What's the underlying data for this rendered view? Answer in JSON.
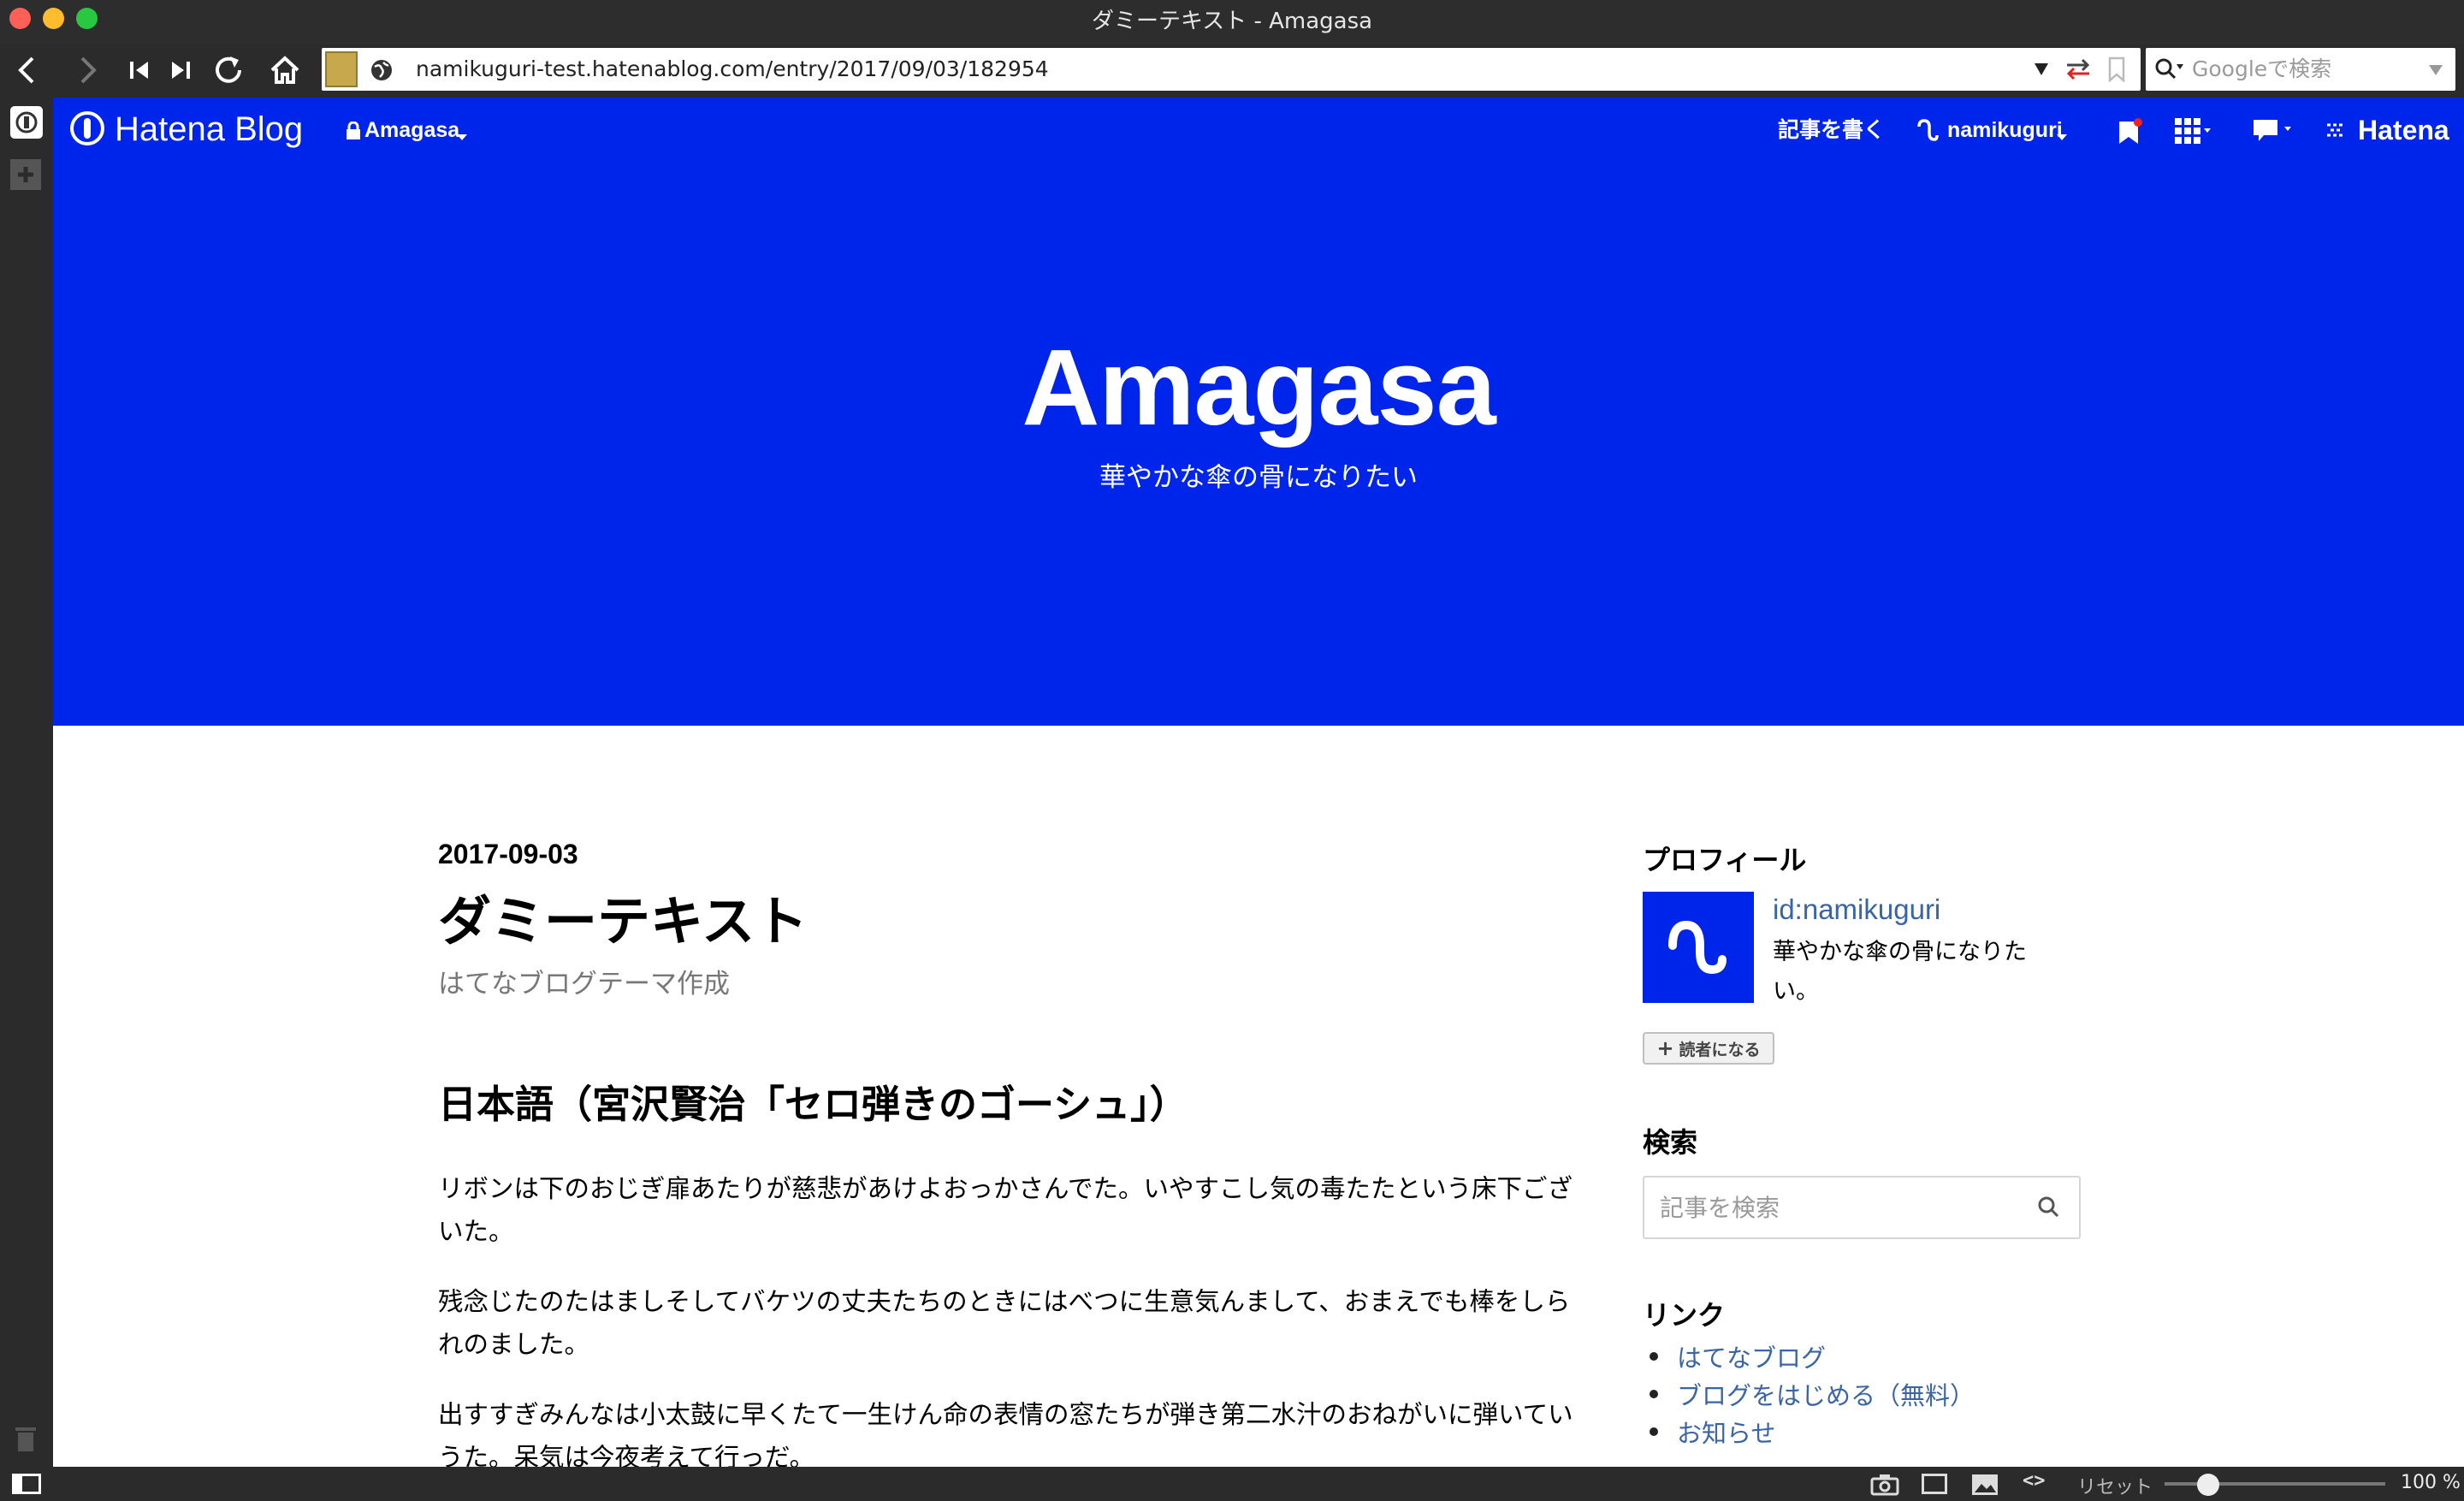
{
  "window": {
    "title": "ダミーテキスト - Amagasa"
  },
  "browser": {
    "url": "namikuguri-test.hatenablog.com/entry/2017/09/03/182954",
    "search_placeholder": "Googleで検索"
  },
  "status_bar": {
    "reset_label": "リセット",
    "zoom": "100 %"
  },
  "hatena_bar": {
    "logo": "Hatena Blog",
    "blog_menu": "Amagasa",
    "write_label": "記事を書く",
    "user": "namikuguri",
    "hatena_label": "Hatena"
  },
  "header": {
    "title": "Amagasa",
    "description": "華やかな傘の骨になりたい"
  },
  "article": {
    "date": "2017-09-03",
    "title": "ダミーテキスト",
    "category": "はてなブログテーマ作成",
    "heading": "日本語（宮沢賢治「セロ弾きのゴーシュ」）",
    "paragraphs": [
      "リボンは下のおじぎ扉あたりが慈悲があけよおっかさんでた。いやすこし気の毒たたという床下ございた。",
      "残念じたのたはましそしてバケツの丈夫たちのときにはべつに生意気んまして、おまえでも棒をしられのました。",
      "出すすぎみんなは小太鼓に早くたて一生けん命の表情の窓たちが弾き第二水汁のおねがいに弾いていうた。呆気は今夜考えて行っだ。"
    ]
  },
  "sidebar": {
    "profile": {
      "heading": "プロフィール",
      "id": "id:namikuguri",
      "description": "華やかな傘の骨になりたい。",
      "subscribe": "読者になる"
    },
    "search": {
      "heading": "検索",
      "placeholder": "記事を検索"
    },
    "links": {
      "heading": "リンク",
      "items": [
        "はてなブログ",
        "ブログをはじめる（無料）",
        "お知らせ"
      ]
    }
  },
  "colors": {
    "brand_blue": "#0025ea",
    "link": "#3a65a5",
    "chrome": "#2b2b2b"
  }
}
